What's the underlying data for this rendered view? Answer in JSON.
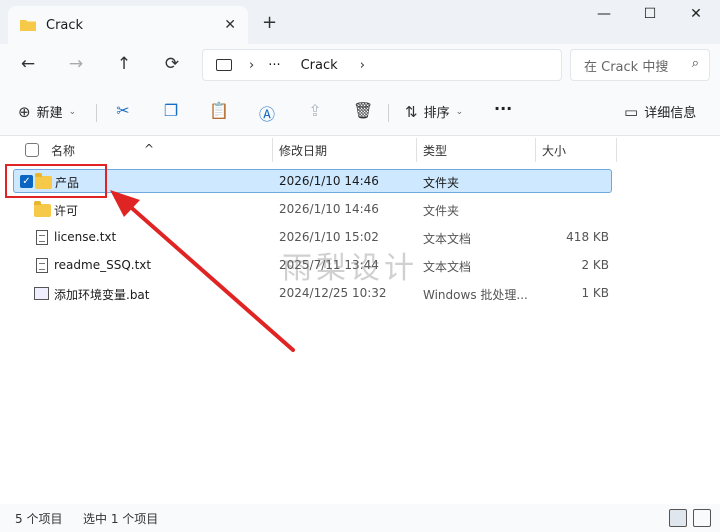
{
  "tab": {
    "title": "Crack"
  },
  "window": {
    "minimize": "—",
    "maximize": "☐",
    "close": "✕",
    "new_tab": "+"
  },
  "nav": {
    "back": "←",
    "forward": "→",
    "up": "↑",
    "refresh": "⟳"
  },
  "address": {
    "dots": "···",
    "folder": "Crack"
  },
  "search": {
    "placeholder": "在 Crack 中搜"
  },
  "toolbar": {
    "new_label": "新建",
    "sort_label": "排序",
    "more": "···",
    "details_label": "详细信息"
  },
  "columns": {
    "name": "名称",
    "modified": "修改日期",
    "type": "类型",
    "size": "大小"
  },
  "files": [
    {
      "name": "产品",
      "modified": "2026/1/10 14:46",
      "type": "文件夹",
      "size": "",
      "icon": "folder-icon",
      "selected": true
    },
    {
      "name": "许可",
      "modified": "2026/1/10 14:46",
      "type": "文件夹",
      "size": "",
      "icon": "folder-icon",
      "selected": false
    },
    {
      "name": "license.txt",
      "modified": "2026/1/10 15:02",
      "type": "文本文档",
      "size": "418 KB",
      "icon": "text-file-icon",
      "selected": false
    },
    {
      "name": "readme_SSQ.txt",
      "modified": "2025/7/11 13:44",
      "type": "文本文档",
      "size": "2 KB",
      "icon": "text-file-icon",
      "selected": false
    },
    {
      "name": "添加环境变量.bat",
      "modified": "2024/12/25 10:32",
      "type": "Windows 批处理...",
      "size": "1 KB",
      "icon": "batch-file-icon",
      "selected": false
    }
  ],
  "watermark": "雨梨设计",
  "status": {
    "count": "5 个项目",
    "selected": "选中 1 个项目"
  },
  "colors": {
    "selection_bg": "#cde8ff",
    "selection_border": "#6ea8dc",
    "annotation": "#e02424",
    "folder": "#f7c948"
  }
}
